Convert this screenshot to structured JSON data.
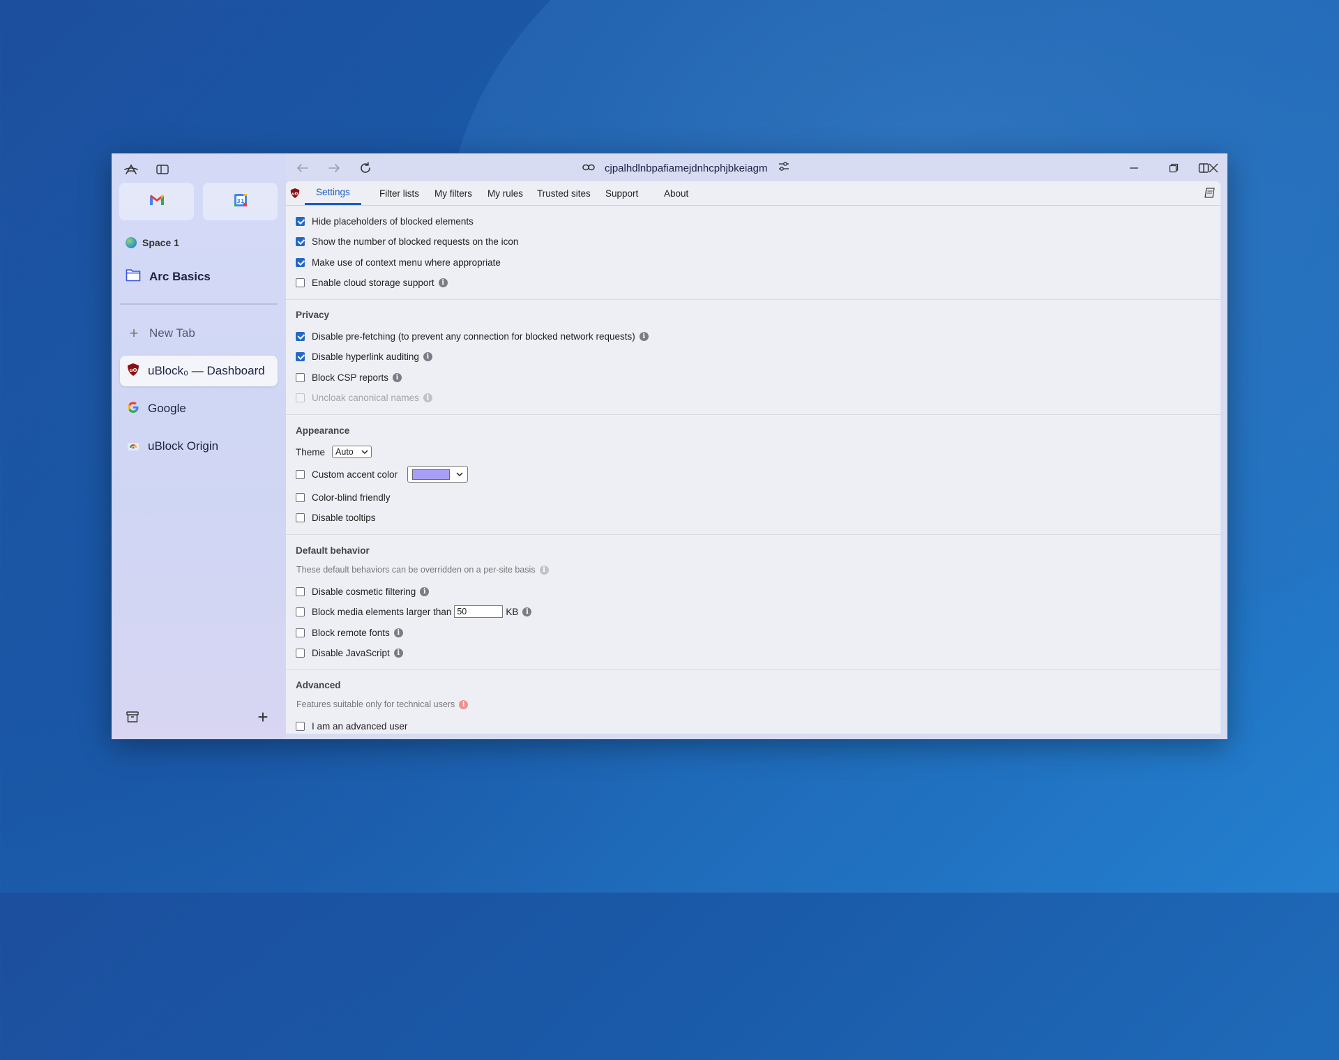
{
  "url": "cjpalhdlnbpafiamejdnhcphjbkeiagm",
  "sidebar": {
    "space_label": "Space 1",
    "folder_label": "Arc Basics",
    "new_tab_label": "New Tab",
    "tabs": [
      {
        "label": "uBlock₀ — Dashboard",
        "icon": "ublock-shield-icon",
        "active": true
      },
      {
        "label": "Google",
        "icon": "google-icon",
        "active": false
      },
      {
        "label": "uBlock Origin",
        "icon": "chrome-web-store-icon",
        "active": false
      }
    ],
    "favorites": [
      "gmail-icon",
      "google-calendar-icon"
    ]
  },
  "tabs": [
    "Settings",
    "Filter lists",
    "My filters",
    "My rules",
    "Trusted sites",
    "Support",
    "About"
  ],
  "settings": {
    "general": [
      {
        "label": "Hide placeholders of blocked elements",
        "checked": true,
        "info": false
      },
      {
        "label": "Show the number of blocked requests on the icon",
        "checked": true,
        "info": false
      },
      {
        "label": "Make use of context menu where appropriate",
        "checked": true,
        "info": false
      },
      {
        "label": "Enable cloud storage support",
        "checked": false,
        "info": true
      }
    ],
    "privacy": {
      "title": "Privacy",
      "items": [
        {
          "label": "Disable pre-fetching (to prevent any connection for blocked network requests)",
          "checked": true
        },
        {
          "label": "Disable hyperlink auditing",
          "checked": true
        },
        {
          "label": "Block CSP reports",
          "checked": false
        },
        {
          "label": "Uncloak canonical names",
          "checked": false,
          "disabled": true
        }
      ]
    },
    "appearance": {
      "title": "Appearance",
      "theme_label": "Theme",
      "theme_value": "Auto",
      "accent_label": "Custom accent color",
      "accent_color": "#a79ff3",
      "colorblind_label": "Color-blind friendly",
      "tooltips_label": "Disable tooltips"
    },
    "default_behavior": {
      "title": "Default behavior",
      "note": "These default behaviors can be overridden on a per-site basis",
      "cosmetic_label": "Disable cosmetic filtering",
      "media_label": "Block media elements larger than",
      "media_value": "50",
      "media_unit": "KB",
      "fonts_label": "Block remote fonts",
      "js_label": "Disable JavaScript"
    },
    "advanced": {
      "title": "Advanced",
      "note": "Features suitable only for technical users",
      "advanced_user_label": "I am an advanced user"
    }
  },
  "colors": {
    "accent": "#1a5bc4",
    "checkbox": "#2468c8",
    "sidebar": "#d4daf6"
  }
}
